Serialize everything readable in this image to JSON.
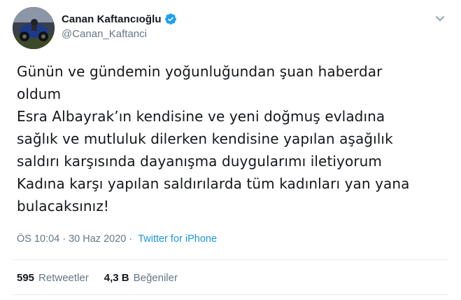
{
  "author": {
    "display_name": "Canan Kaftancıoğlu",
    "handle": "@Canan_Kaftanci",
    "verified": true
  },
  "tweet": {
    "text": "Günün ve gündemin yoğunluğundan şuan haberdar\noldum\nEsra Albayrak’ın kendisine ve yeni doğmuş evladına\nsağlık ve mutluluk dilerken kendisine yapılan aşağılık\nsaldırı karşısında dayanışma duygularımı iletiyorum\nKadına karşı yapılan saldırılarda tüm kadınları yan yana\nbulacaksınız!",
    "time": "ÖS 10:04",
    "separator": "·",
    "date": "30 Haz 2020",
    "source_separator": "·",
    "source": "Twitter for iPhone"
  },
  "stats": {
    "retweets_count": "595",
    "retweets_label": "Retweetler",
    "likes_count": "4,3 B",
    "likes_label": "Beğeniler"
  },
  "colors": {
    "link": "#1b95e0",
    "verified": "#1da1f2",
    "secondary_text": "#657786",
    "divider": "#e6ecf0"
  },
  "icons": {
    "verified": "verified-badge-icon",
    "menu": "chevron-down-icon"
  }
}
